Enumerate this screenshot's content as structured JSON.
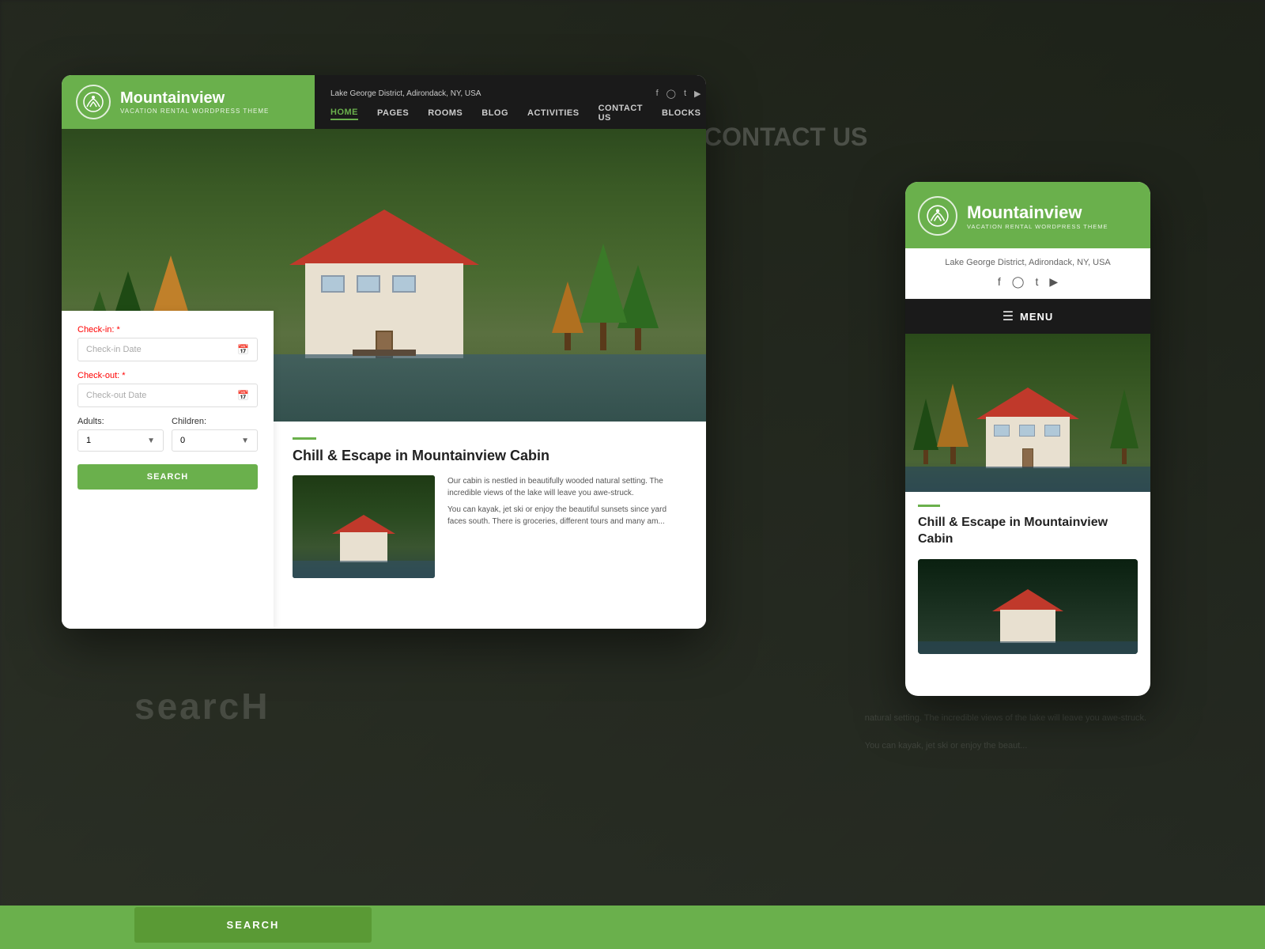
{
  "background": {
    "search_text": "searcH",
    "contact_text": "CONTACT US"
  },
  "desktop": {
    "logo": {
      "name": "Mountainview",
      "tagline": "VACATION RENTAL WORDPRESS THEME"
    },
    "header": {
      "address": "Lake George District, Adirondack, NY, USA",
      "social": [
        "f",
        "in",
        "tw",
        "yt"
      ]
    },
    "nav": {
      "items": [
        "HOME",
        "PAGES",
        "ROOMS",
        "BLOG",
        "ACTIVITIES",
        "CONTACT US",
        "BLOCKS"
      ],
      "active": "HOME"
    },
    "booking": {
      "checkin_label": "Check-in:",
      "checkin_placeholder": "Check-in Date",
      "checkout_label": "Check-out:",
      "checkout_placeholder": "Check-out Date",
      "adults_label": "Adults:",
      "adults_value": "1",
      "children_label": "Children:",
      "children_value": "0",
      "search_btn": "SEARCH"
    },
    "content": {
      "title": "Chill & Escape in Mountainview Cabin",
      "body1": "Our cabin is nestled in beautifully wooded natural setting. The incredible views of the lake will leave you awe-struck.",
      "body2": "You can kayak, jet ski or enjoy the beautiful sunsets since yard faces south. There is groceries, different tours and many am..."
    }
  },
  "mobile": {
    "logo": {
      "name": "Mountainview",
      "tagline": "VACATION RENTAL WORDPRESS THEME"
    },
    "header": {
      "address": "Lake George District, Adirondack, NY, USA",
      "menu_label": "MENU"
    },
    "content": {
      "title": "Chill & Escape in Mountainview Cabin"
    }
  }
}
